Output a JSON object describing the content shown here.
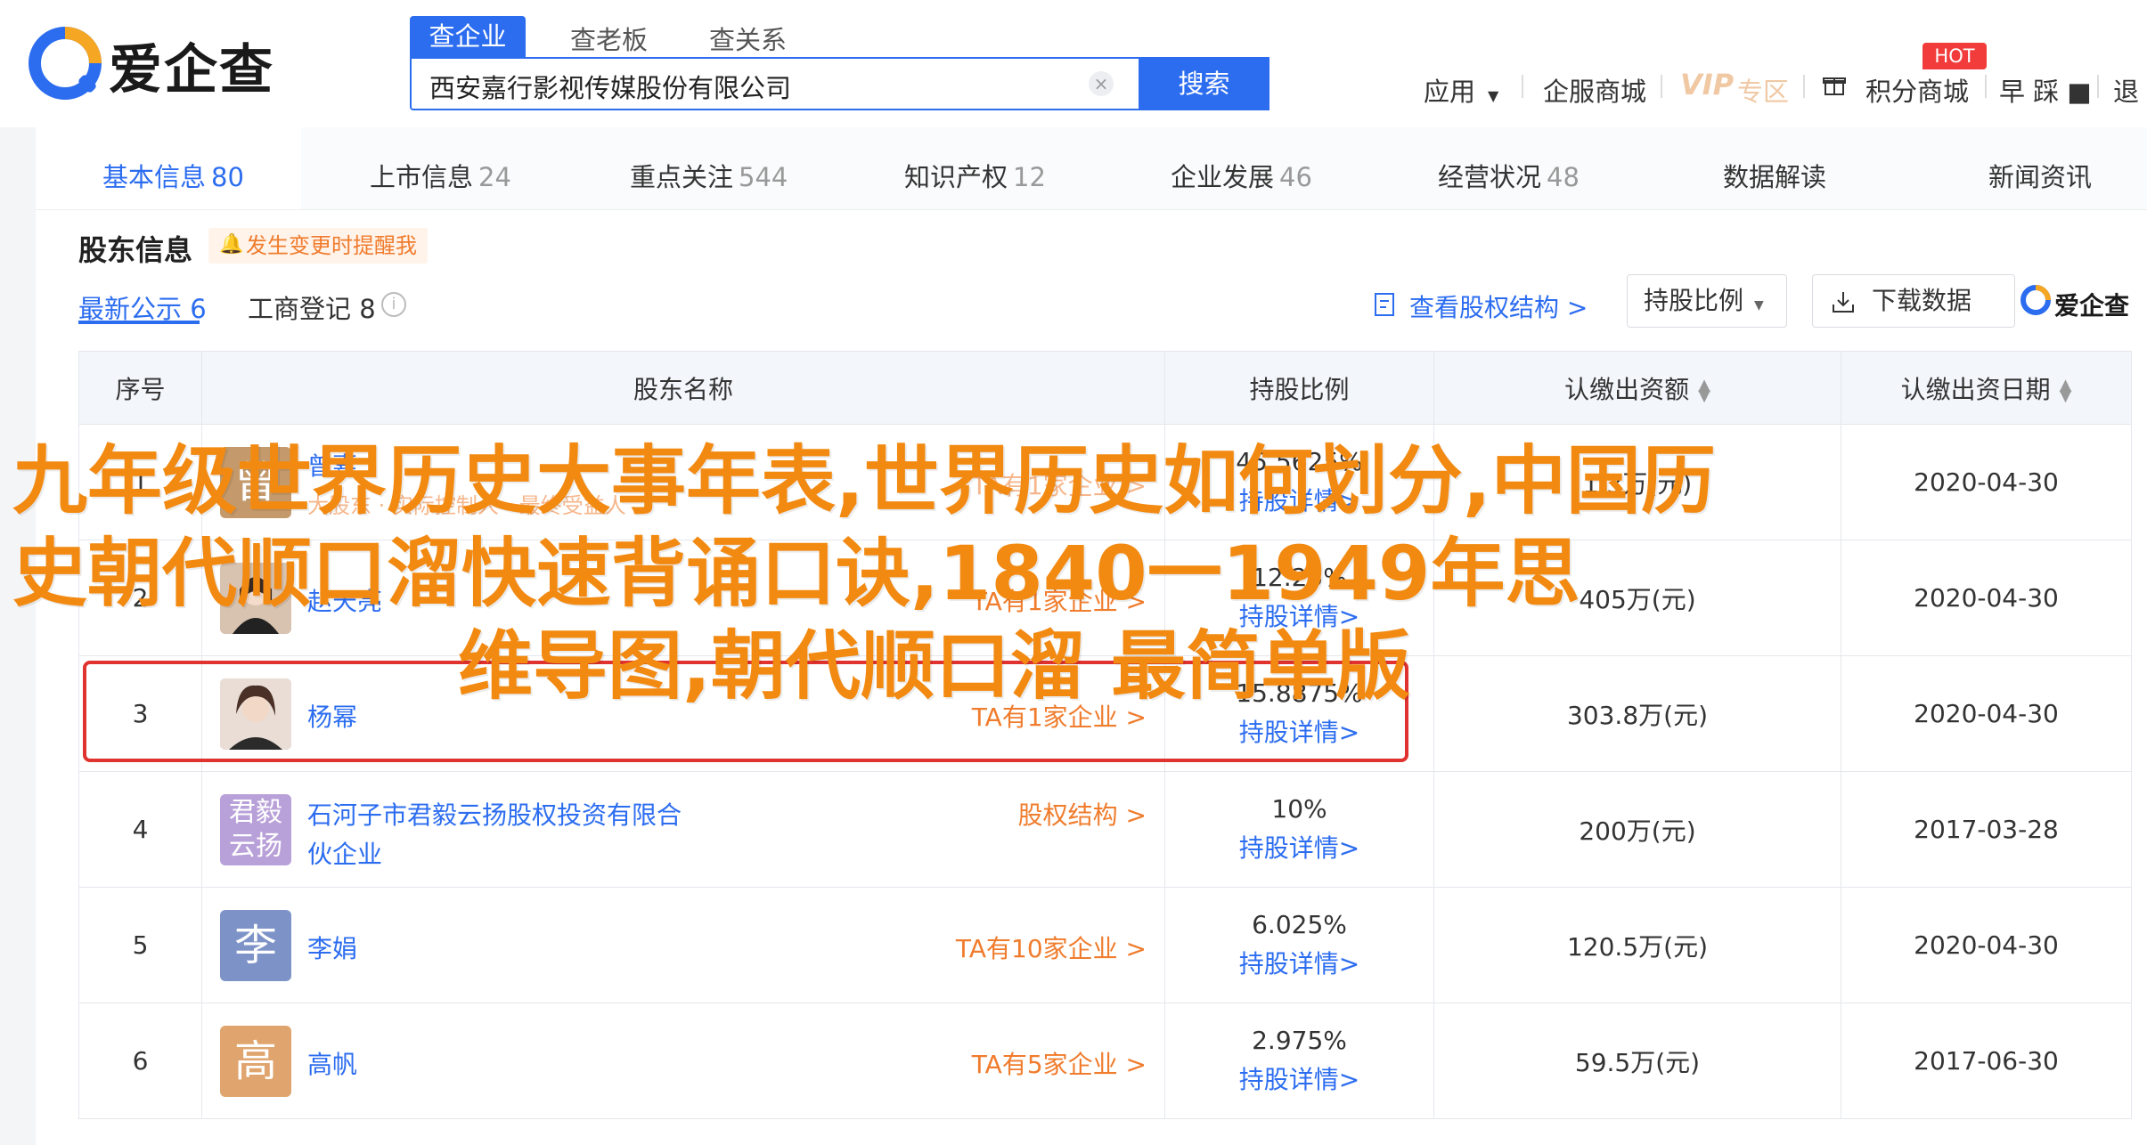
{
  "brand": {
    "name": "爱企查",
    "accent": "#2c6df0",
    "orange": "#f07c2d"
  },
  "search": {
    "tabs": [
      "查企业",
      "查老板",
      "查关系"
    ],
    "value": "西安嘉行影视传媒股份有限公司",
    "button": "搜索"
  },
  "header_nav": {
    "apps": "应用",
    "service": "企服商城",
    "vip": "VIP",
    "vip_zone": "专区",
    "hot_badge": "HOT",
    "points": "积分商城",
    "user": "早 踩 ■",
    "login": "退"
  },
  "nav_tabs": [
    {
      "label": "基本信息",
      "count": "80"
    },
    {
      "label": "上市信息",
      "count": "24"
    },
    {
      "label": "重点关注",
      "count": "544"
    },
    {
      "label": "知识产权",
      "count": "12"
    },
    {
      "label": "企业发展",
      "count": "46"
    },
    {
      "label": "经营状况",
      "count": "48"
    },
    {
      "label": "数据解读",
      "count": ""
    },
    {
      "label": "新闻资讯",
      "count": ""
    }
  ],
  "section": {
    "title": "股东信息",
    "alert": "发生变更时提醒我",
    "subtab_latest": "最新公示 6",
    "subtab_registry": "工商登记 8",
    "view_structure": "查看股权结构 >",
    "dropdown": "持股比例",
    "download": "下载数据",
    "logo_small": "爱企查"
  },
  "table": {
    "headers": [
      "序号",
      "股东名称",
      "持股比例",
      "认缴出资额",
      "认缴出资日期"
    ],
    "rows": [
      {
        "no": "1",
        "name": "曾嘉",
        "tag": "大股东 · 实际控制人 · 最终受益人",
        "link": "TA有1家企业 >",
        "pct": "45.5625%",
        "detail": "持股详情>",
        "amount": "1.3万(元)",
        "date": "2020-04-30",
        "avatar_text": "曾",
        "avatar_color": "#c49a6c"
      },
      {
        "no": "2",
        "name": "赵天亮",
        "tag": "",
        "link": "TA有1家企业 >",
        "pct": "12.25%",
        "detail": "持股详情>",
        "amount": "405万(元)",
        "date": "2020-04-30",
        "avatar_text": "",
        "avatar_color": "#d8c2b0"
      },
      {
        "no": "3",
        "name": "杨幂",
        "tag": "",
        "link": "TA有1家企业 >",
        "pct": "15.8875%",
        "detail": "持股详情>",
        "amount": "303.8万(元)",
        "date": "2020-04-30",
        "avatar_text": "",
        "avatar_color": "#b89a8a"
      },
      {
        "no": "4",
        "name": "石河子市君毅云扬股权投资有限合伙企业",
        "name_line1": "石河子市君毅云扬股权投资有限合",
        "name_line2": "伙企业",
        "tag": "",
        "link": "股权结构 >",
        "pct": "10%",
        "detail": "持股详情>",
        "amount": "200万(元)",
        "date": "2017-03-28",
        "avatar_text": "君毅云扬",
        "avatar_color": "#b8a0d8"
      },
      {
        "no": "5",
        "name": "李娟",
        "tag": "",
        "link": "TA有10家企业 >",
        "pct": "6.025%",
        "detail": "持股详情>",
        "amount": "120.5万(元)",
        "date": "2020-04-30",
        "avatar_text": "李",
        "avatar_color": "#7d93c7"
      },
      {
        "no": "6",
        "name": "高帆",
        "tag": "",
        "link": "TA有5家企业 >",
        "pct": "2.975%",
        "detail": "持股详情>",
        "amount": "59.5万(元)",
        "date": "2017-06-30",
        "avatar_text": "高",
        "avatar_color": "#e0a56e"
      }
    ]
  },
  "overlay": {
    "line1": "九年级世界历史大事年表,世界历史如何划分,中国历",
    "line2": "史朝代顺口溜快速背诵口诀,1840一1949年思",
    "line3": "维导图,朝代顺口溜 最简单版",
    "color": "#f28a12"
  }
}
